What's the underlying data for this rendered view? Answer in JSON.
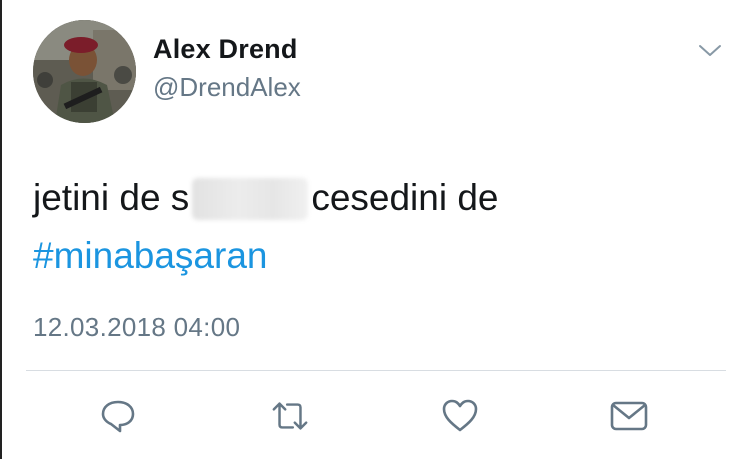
{
  "tweet": {
    "author_name": "Alex Drend",
    "author_handle": "@DrendAlex",
    "text_before": "jetini de s",
    "text_after": "cesedini de",
    "hashtag": "#minabaşaran",
    "timestamp": "12.03.2018 04:00"
  },
  "icons": {
    "menu": "chevron-down-icon",
    "reply": "reply-icon",
    "retweet": "retweet-icon",
    "like": "heart-icon",
    "message": "envelope-icon"
  },
  "colors": {
    "text": "#14171a",
    "secondary": "#657786",
    "link": "#1b95e0",
    "icon": "#657786"
  }
}
